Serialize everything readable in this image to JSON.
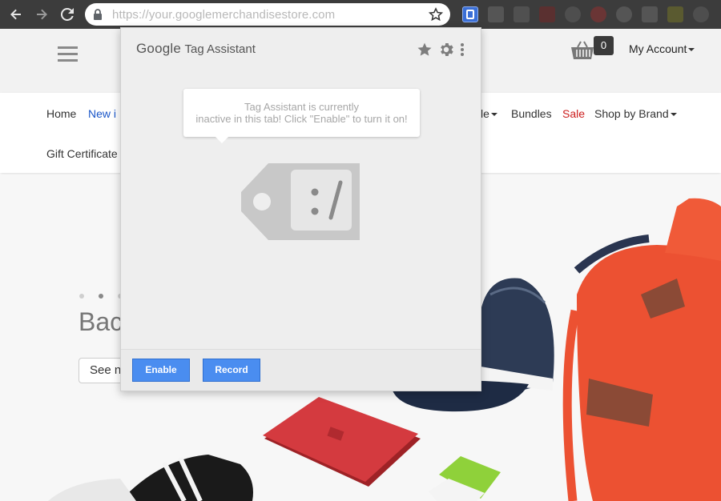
{
  "browser": {
    "url": "https://your.googlemerchandisestore.com",
    "extensions": [
      "tag-assistant-icon",
      "extension-icon-2",
      "extension-icon-3",
      "extension-icon-4",
      "extension-icon-5",
      "extension-icon-6",
      "extension-icon-7",
      "extension-icon-8",
      "extension-icon-9",
      "extension-icon-10"
    ]
  },
  "site": {
    "cart_count": "0",
    "my_account": "My Account",
    "nav": {
      "home": "Home",
      "new": "New i",
      "hidden_partial": "le",
      "bundles": "Bundles",
      "sale": "Sale",
      "shop_by_brand": "Shop by Brand",
      "gift": "Gift Certificate"
    },
    "hero": {
      "title": "Bac",
      "button": "See n"
    }
  },
  "popup": {
    "brand": "Google",
    "title": "Tag Assistant",
    "message_line1": "Tag Assistant is currently",
    "message_line2": "inactive in this tab! Click \"Enable\" to turn it on!",
    "enable_label": "Enable",
    "record_label": "Record"
  },
  "colors": {
    "chrome_bar": "#3c3c3c",
    "button_blue": "#4a8df0",
    "link_blue": "#1a56c8",
    "sale_red": "#cc1d1d",
    "backpack_orange": "#ec5132"
  }
}
